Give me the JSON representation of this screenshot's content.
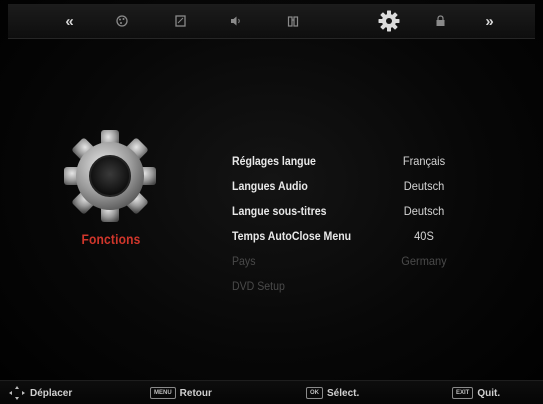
{
  "nav": {
    "items": [
      {
        "id": "prev",
        "icon": "double-chevron-left-icon",
        "glyph": "«"
      },
      {
        "id": "picture",
        "icon": "palette-icon"
      },
      {
        "id": "screen",
        "icon": "screen-icon"
      },
      {
        "id": "sound",
        "icon": "speaker-icon"
      },
      {
        "id": "channel",
        "icon": "tuner-icon"
      },
      {
        "id": "functions",
        "icon": "gear-icon",
        "selected": true
      },
      {
        "id": "lock",
        "icon": "lock-icon"
      },
      {
        "id": "next",
        "icon": "double-chevron-right-icon",
        "glyph": "»"
      }
    ]
  },
  "category": {
    "icon": "large-gear-icon",
    "label": "Fonctions",
    "label_color": "#d0362b"
  },
  "menu": {
    "rows": [
      {
        "label": "Réglages langue",
        "value": "Français",
        "enabled": true
      },
      {
        "label": "Langues Audio",
        "value": "Deutsch",
        "enabled": true
      },
      {
        "label": "Langue sous-titres",
        "value": "Deutsch",
        "enabled": true
      },
      {
        "label": "Temps AutoClose Menu",
        "value": "40S",
        "enabled": true
      },
      {
        "label": "Pays",
        "value": "Germany",
        "enabled": false
      },
      {
        "label": "DVD Setup",
        "value": "",
        "enabled": false
      }
    ]
  },
  "help": {
    "move": {
      "icon": "dpad-icon",
      "label": "Déplacer"
    },
    "back": {
      "key": "MENU",
      "label": "Retour"
    },
    "select": {
      "key": "OK",
      "label": "Sélect."
    },
    "quit": {
      "key": "EXIT",
      "label": "Quit."
    }
  }
}
